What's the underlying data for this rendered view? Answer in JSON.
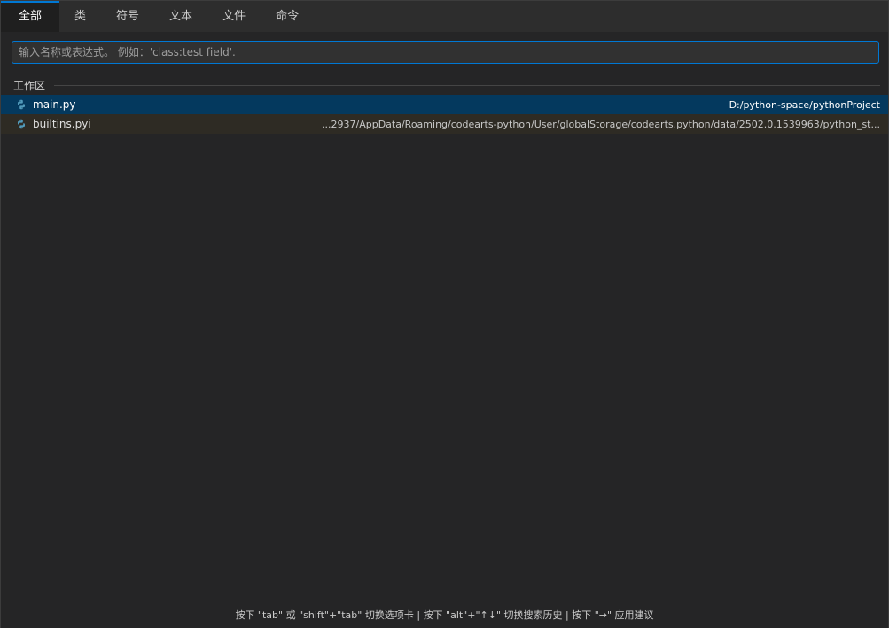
{
  "tabs": [
    {
      "label": "全部",
      "active": true
    },
    {
      "label": "类",
      "active": false
    },
    {
      "label": "符号",
      "active": false
    },
    {
      "label": "文本",
      "active": false
    },
    {
      "label": "文件",
      "active": false
    },
    {
      "label": "命令",
      "active": false
    }
  ],
  "search": {
    "value": "",
    "placeholder": "输入名称或表达式。 例如：'class:test field'."
  },
  "section": {
    "label": "工作区"
  },
  "results": [
    {
      "icon": "python-file-icon",
      "name": "main.py",
      "path": "D:/python-space/pythonProject",
      "state": "selected"
    },
    {
      "icon": "python-file-icon",
      "name": "builtins.pyi",
      "path": "...2937/AppData/Roaming/codearts-python/User/globalStorage/codearts.python/data/2502.0.1539963/python_st...",
      "state": "hover"
    }
  ],
  "footer": {
    "hint": "按下 \"tab\" 或 \"shift\"+\"tab\" 切换选项卡 | 按下 \"alt\"+\"↑↓\" 切换搜索历史 | 按下 \"→\" 应用建议"
  },
  "colors": {
    "accent": "#0078d4",
    "selection": "#04395e",
    "python_blue": "#519aba"
  }
}
